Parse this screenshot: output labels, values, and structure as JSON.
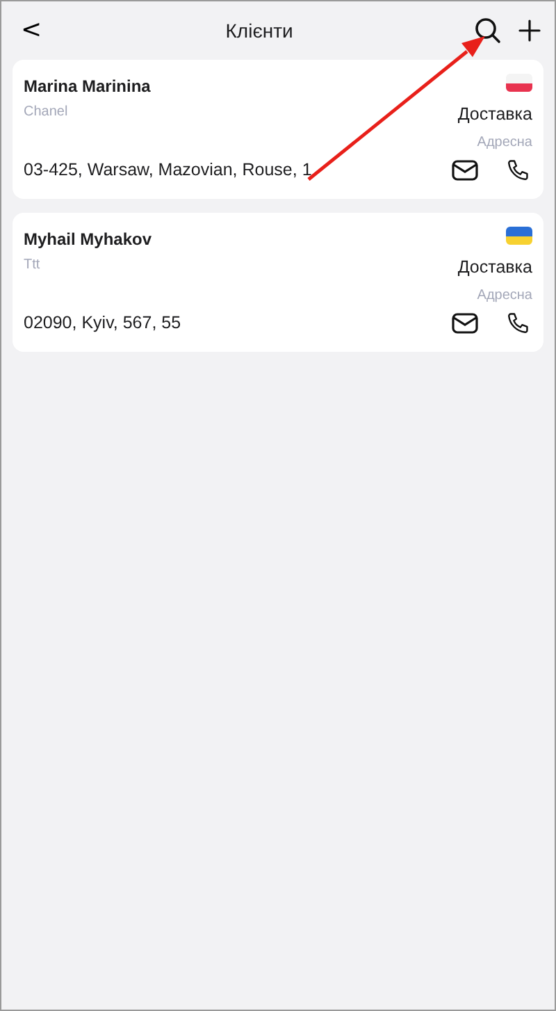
{
  "header": {
    "back": "<",
    "title": "Клієнти"
  },
  "clients": [
    {
      "name": "Marina Marinina",
      "subtitle": "Chanel",
      "flag": [
        {
          "color": "#f4f4f4"
        },
        {
          "color": "#e8334f"
        }
      ],
      "delivery": "Доставка",
      "address_label": "Адресна",
      "address": "03-425, Warsaw, Mazovian, Rouse, 1"
    },
    {
      "name": "Myhail Myhakov",
      "subtitle": "Ttt",
      "flag": [
        {
          "color": "#2a6fd6"
        },
        {
          "color": "#f7d130"
        }
      ],
      "delivery": "Доставка",
      "address_label": "Адресна",
      "address": "02090, Kyiv, 567, 55"
    }
  ],
  "annotation": {
    "kind": "arrow",
    "color": "#e8201a"
  }
}
